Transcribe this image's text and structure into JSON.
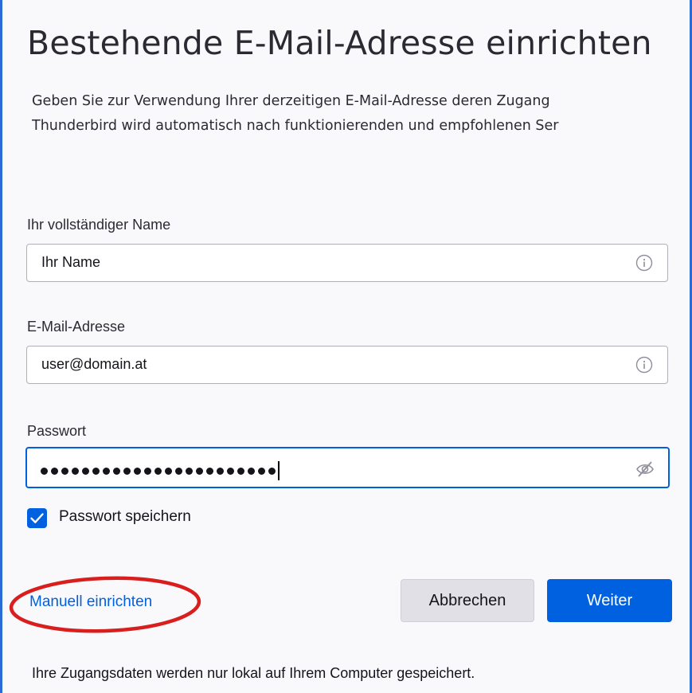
{
  "header": {
    "title": "Bestehende E-Mail-Adresse einrichten",
    "description_line1": "Geben Sie zur Verwendung Ihrer derzeitigen E-Mail-Adresse deren Zugang",
    "description_line2": "Thunderbird wird automatisch nach funktionierenden und empfohlenen Ser"
  },
  "form": {
    "name": {
      "label": "Ihr vollständiger Name",
      "value": "Ihr Name",
      "icon": "info-icon"
    },
    "email": {
      "label": "E-Mail-Adresse",
      "value": "user@domain.at",
      "icon": "info-icon"
    },
    "password": {
      "label": "Passwort",
      "masked_length": 23,
      "icon": "eye-slash-icon"
    },
    "remember": {
      "label": "Passwort speichern",
      "checked": true
    }
  },
  "actions": {
    "manual_setup": "Manuell einrichten",
    "cancel": "Abbrechen",
    "next": "Weiter"
  },
  "footer": {
    "note": "Ihre Zugangsdaten werden nur lokal auf Ihrem Computer gespeichert."
  },
  "colors": {
    "accent": "#0061e0",
    "highlight_circle": "#d91e1e",
    "frame": "#2b6bd6"
  }
}
